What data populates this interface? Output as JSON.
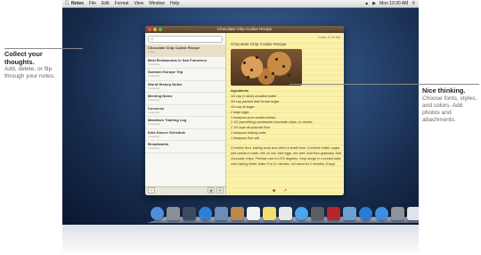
{
  "menubar": {
    "app": "Notes",
    "menus": [
      "File",
      "Edit",
      "Format",
      "View",
      "Window",
      "Help"
    ],
    "clock": "Mon 10:30 AM"
  },
  "window": {
    "title": "Chocolate Chip Cookie Recipe",
    "search_placeholder": "Q",
    "notes": [
      {
        "title": "Chocolate Chip Cookie Recipe",
        "date": "Today"
      },
      {
        "title": "Best Restaurants in San Francisco",
        "date": "Yesterday"
      },
      {
        "title": "Summer Europe Trip",
        "date": "Yesterday"
      },
      {
        "title": "World History Notes",
        "date": "Yesterday"
      },
      {
        "title": "Meeting Notes",
        "date": "Yesterday"
      },
      {
        "title": "Converse",
        "date": "Yesterday"
      },
      {
        "title": "Marathon Training Log",
        "date": "Yesterday"
      },
      {
        "title": "Kids Soccer Schedule",
        "date": "Yesterday"
      },
      {
        "title": "Broadwards",
        "date": "Yesterday"
      }
    ],
    "note": {
      "date": "Today 10:30 AM",
      "title": "Chocolate Chip Cookie Recipe",
      "ingredients_heading": "Ingredients",
      "ingredients": [
        "1/2 cup (1 stick) unsalted butter",
        "3/4 cup packed dark brown sugar",
        "1/4 cup of sugar",
        "2 large eggs",
        "1 teaspoon pure vanilla extract",
        "1 1/2 (something) semisweet chocolate chips, or chunks",
        "2 1/4 cups all-purpose flour",
        "1 teaspoon baking soda",
        "1 teaspoon fine salt"
      ],
      "directions": "Combine flour, baking soda and salt in a small bowl. Combine butter, sugar and vanilla in mixer. Mix on low. Add eggs, mix well. Add flour gradually. Add chocolate chips. Preheat oven to 375 degrees. Drop dough in rounded balls onto baking sheet. Bake 9 to 11 minutes. Let stand for 2 minutes. Enjoy!"
    },
    "sidebar_add": "+",
    "toolbar_delete_icon": "trash-icon",
    "toolbar_share_icon": "share-icon"
  },
  "callouts": {
    "left_heading": "Collect your thoughts.",
    "left_body": "Add, delete, or flip through your notes.",
    "right_heading": "Nice thinking.",
    "right_body": "Choose fonts, styles, and colors. Add photos and attachments."
  },
  "dock": [
    {
      "name": "finder",
      "color": "#4f8fd8"
    },
    {
      "name": "launchpad",
      "color": "#8a8f98"
    },
    {
      "name": "mission-control",
      "color": "#3b4b5f"
    },
    {
      "name": "safari",
      "color": "#2f7ed8"
    },
    {
      "name": "mail",
      "color": "#6b8db8"
    },
    {
      "name": "contacts",
      "color": "#b88a4f"
    },
    {
      "name": "calendar",
      "color": "#f2f2f2"
    },
    {
      "name": "notes",
      "color": "#f1df6e"
    },
    {
      "name": "reminders",
      "color": "#e9e9e9"
    },
    {
      "name": "messages",
      "color": "#4ea4ee"
    },
    {
      "name": "facetime",
      "color": "#5a5f66"
    },
    {
      "name": "photo-booth",
      "color": "#b7262a"
    },
    {
      "name": "iphoto",
      "color": "#6aa2d6"
    },
    {
      "name": "itunes",
      "color": "#2a7bd4"
    },
    {
      "name": "app-store",
      "color": "#3f8fe0"
    },
    {
      "name": "system-preferences",
      "color": "#8d939b"
    },
    {
      "name": "downloads",
      "color": "#dfe4ea"
    },
    {
      "name": "trash",
      "color": "#aab1b9"
    }
  ]
}
